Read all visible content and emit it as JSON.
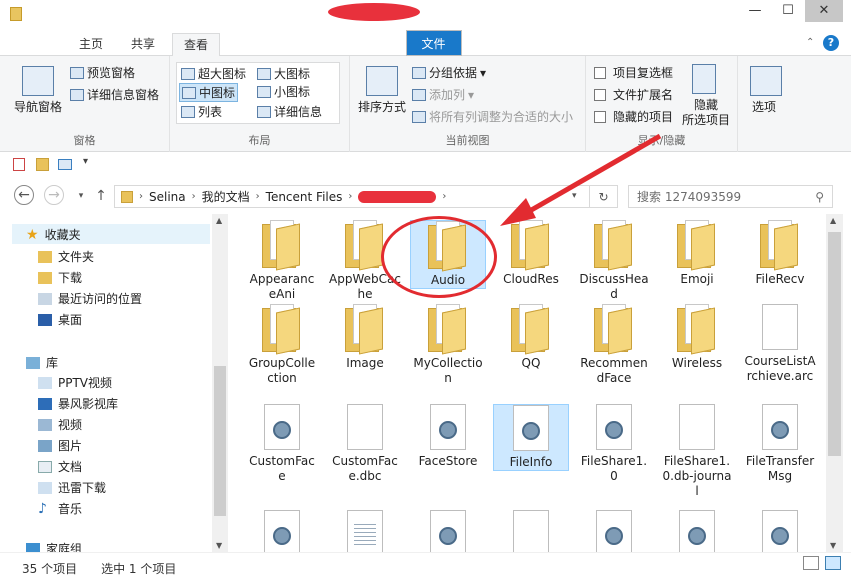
{
  "window": {
    "minimize": "—",
    "maximize": "☐",
    "close": "✕"
  },
  "tabs": [
    {
      "label": "文件"
    },
    {
      "label": "主页"
    },
    {
      "label": "共享"
    },
    {
      "label": "查看"
    }
  ],
  "ribbon": {
    "panes": {
      "nav_pane": "导航窗格",
      "preview": "预览窗格",
      "details": "详细信息窗格",
      "label": "窗格"
    },
    "layout": {
      "xl": "超大图标",
      "large": "大图标",
      "medium": "中图标",
      "small": "小图标",
      "list": "列表",
      "details": "详细信息",
      "label": "布局"
    },
    "current_view": {
      "sort": "排序方式",
      "group": "分组依据",
      "add_column": "添加列",
      "fit_columns": "将所有列调整为合适的大小",
      "label": "当前视图"
    },
    "show_hide": {
      "item_checkboxes": "项目复选框",
      "extensions": "文件扩展名",
      "hidden_items": "隐藏的项目",
      "hide_selected": "隐藏\n所选项目",
      "label": "显示/隐藏"
    },
    "options": "选项"
  },
  "address": {
    "crumbs": [
      "Selina",
      "我的文档",
      "Tencent Files"
    ],
    "search_placeholder": "搜索 1274093599"
  },
  "navpane": {
    "favorites": "收藏夹",
    "fav_items": [
      "文件夹",
      "下载",
      "最近访问的位置",
      "桌面"
    ],
    "library": "库",
    "lib_items": [
      "PPTV视频",
      "暴风影视库",
      "视频",
      "图片",
      "文档",
      "迅雷下载",
      "音乐"
    ],
    "homegroup": "家庭组"
  },
  "items": [
    {
      "label": "AppearanceAni",
      "kind": "folder"
    },
    {
      "label": "AppWebCache",
      "kind": "folder"
    },
    {
      "label": "Audio",
      "kind": "folder"
    },
    {
      "label": "CloudRes",
      "kind": "folder"
    },
    {
      "label": "DiscussHead",
      "kind": "folder"
    },
    {
      "label": "Emoji",
      "kind": "folder"
    },
    {
      "label": "FileRecv",
      "kind": "folder"
    },
    {
      "label": "GroupCollection",
      "kind": "folder"
    },
    {
      "label": "Image",
      "kind": "folder"
    },
    {
      "label": "MyCollection",
      "kind": "folder"
    },
    {
      "label": "QQ",
      "kind": "folder"
    },
    {
      "label": "RecommendFace",
      "kind": "folder"
    },
    {
      "label": "Wireless",
      "kind": "folder"
    },
    {
      "label": "CourseListArchieve.arc",
      "kind": "file"
    },
    {
      "label": "CustomFace",
      "kind": "gear"
    },
    {
      "label": "CustomFace.dbc",
      "kind": "file"
    },
    {
      "label": "FaceStore",
      "kind": "gear"
    },
    {
      "label": "FileInfo",
      "kind": "gear"
    },
    {
      "label": "FileShare1.0",
      "kind": "gear"
    },
    {
      "label": "FileShare1.0.db-journal",
      "kind": "file"
    },
    {
      "label": "FileTransferMsg",
      "kind": "gear"
    }
  ],
  "status": {
    "count": "35 个项目",
    "selected": "选中 1 个项目"
  }
}
